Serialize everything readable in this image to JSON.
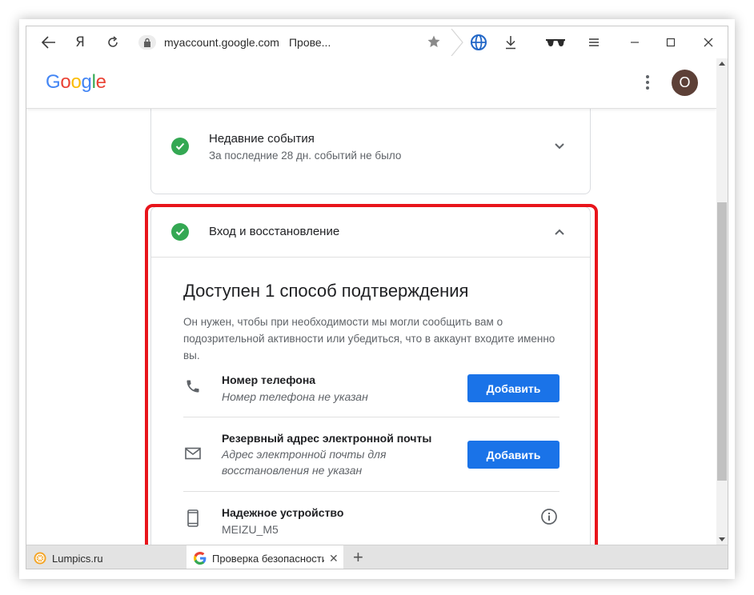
{
  "browser": {
    "yandex_label": "Я",
    "url_domain": "myaccount.google.com",
    "url_title": "Прове..."
  },
  "header": {
    "logo_letters": [
      {
        "char": "G",
        "color": "#4285f4"
      },
      {
        "char": "o",
        "color": "#ea4335"
      },
      {
        "char": "o",
        "color": "#fbbc05"
      },
      {
        "char": "g",
        "color": "#4285f4"
      },
      {
        "char": "l",
        "color": "#34a853"
      },
      {
        "char": "e",
        "color": "#ea4335"
      }
    ],
    "avatar_letter": "O",
    "avatar_color": "#5d4037"
  },
  "recent_events": {
    "title": "Недавние события",
    "subtitle": "За последние 28 дн. событий не было"
  },
  "signin": {
    "title": "Вход и восстановление",
    "heading": "Доступен 1 способ подтверждения",
    "description": "Он нужен, чтобы при необходимости мы могли сообщить вам о подозрительной активности или убедиться, что в аккаунт входите именно вы.",
    "items": [
      {
        "icon": "phone-icon",
        "title": "Номер телефона",
        "subtitle": "Номер телефона не указан",
        "button": "Добавить"
      },
      {
        "icon": "mail-icon",
        "title": "Резервный адрес электронной почты",
        "subtitle": "Адрес электронной почты для восстановления не указан",
        "button": "Добавить"
      },
      {
        "icon": "smartphone-icon",
        "title": "Надежное устройство",
        "subtitle": "MEIZU_M5"
      }
    ]
  },
  "tabs": [
    {
      "label": "Lumpics.ru"
    },
    {
      "label": "Проверка безопасности"
    }
  ],
  "colors": {
    "accent": "#1a73e8",
    "success": "#34a853",
    "highlight": "#e8141b"
  }
}
